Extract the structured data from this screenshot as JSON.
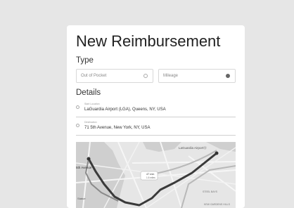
{
  "form": {
    "title": "New Reimbursement",
    "type_heading": "Type",
    "options": [
      {
        "label": "Out of Pocket",
        "selected": false
      },
      {
        "label": "Mileage",
        "selected": true
      }
    ],
    "details_heading": "Details",
    "start": {
      "caption": "Start Location",
      "value": "LaGuardia Airport (LGA), Queens, NY, USA"
    },
    "destination": {
      "caption": "Destination",
      "value": "71 5th Avenue, New York, NY, USA"
    }
  },
  "map": {
    "label_airport": "LaGuardia AirportⓈ",
    "label_5th": "5th Avenue",
    "label_route": "47 min",
    "label_route2": "1.5 miles",
    "label_statue": "Statue",
    "label_bay": "STEEL BAYS",
    "label_hills": "KEW GARDENS HILLS"
  }
}
